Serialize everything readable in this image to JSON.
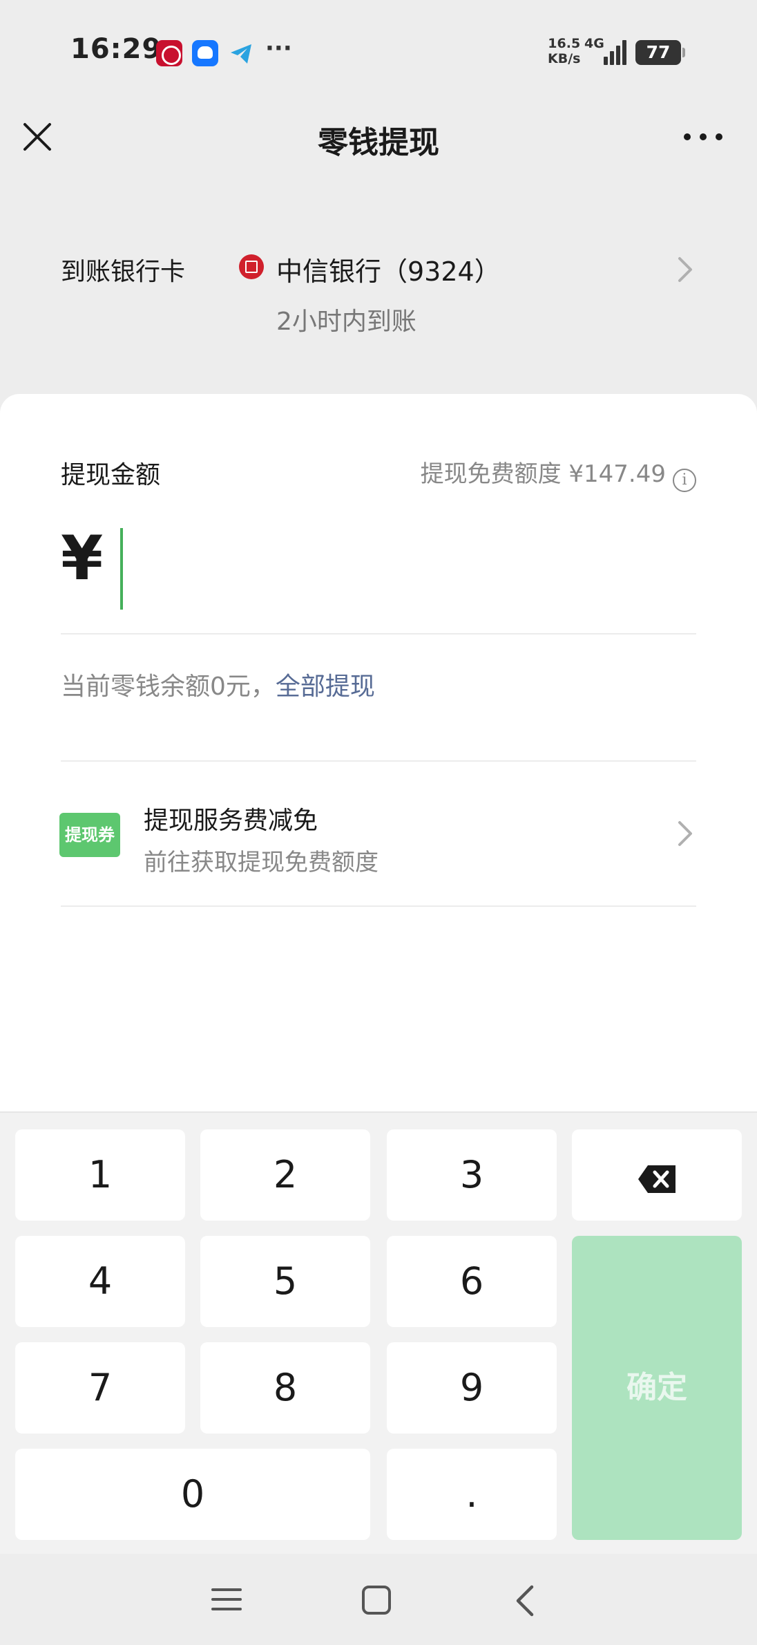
{
  "status_bar": {
    "time": "16:29",
    "speed_value": "16.5",
    "speed_unit": "KB/s",
    "network": "4G",
    "battery": "77",
    "more": "···",
    "app_icons": [
      "bank-app-icon",
      "chat-app-icon",
      "telegram-icon"
    ]
  },
  "nav": {
    "title": "零钱提现"
  },
  "bank": {
    "label": "到账银行卡",
    "name": "中信银行（9324）",
    "eta": "2小时内到账"
  },
  "withdraw": {
    "amount_label": "提现金额",
    "free_quota": "提现免费额度 ¥147.49",
    "info_glyph": "i",
    "currency": "¥",
    "amount_value": "",
    "balance_text": "当前零钱余额0元，",
    "withdraw_all": "全部提现"
  },
  "fee": {
    "badge": "提现券",
    "title": "提现服务费减免",
    "subtitle": "前往获取提现免费额度"
  },
  "keypad": {
    "keys": [
      "1",
      "2",
      "3",
      "4",
      "5",
      "6",
      "7",
      "8",
      "9",
      "0",
      "."
    ],
    "confirm": "确定"
  },
  "colors": {
    "accent_green": "#45b05a",
    "confirm_disabled": "#ade3bf",
    "link_blue": "#576b95",
    "badge_green": "#5dc76f"
  }
}
